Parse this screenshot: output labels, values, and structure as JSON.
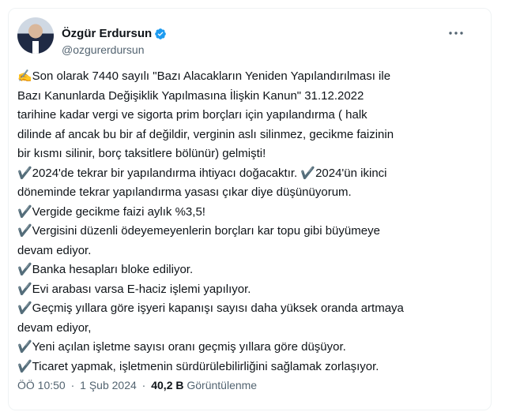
{
  "author": {
    "name": "Özgür Erdursun",
    "handle": "@ozgurerdursun",
    "verified_icon": "verified-badge-icon",
    "more_icon": "more-dots-icon"
  },
  "tweet": {
    "lines": [
      "✍️Son olarak 7440 sayılı \"Bazı Alacakların Yeniden Yapılandırılması ile",
      "Bazı Kanunlarda Değişiklik Yapılmasına İlişkin Kanun\"  31.12.2022",
      "tarihine kadar vergi ve sigorta prim borçları için yapılandırma ( halk",
      "dilinde af ancak bu bir af değildir, verginin aslı silinmez, gecikme faizinin",
      "bir kısmı silinir, borç taksitlere bölünür) gelmişti!",
      "✔️2024'de tekrar bir yapılandırma ihtiyacı doğacaktır. ✔️2024'ün ikinci",
      "döneminde tekrar yapılandırma yasası çıkar diye düşünüyorum.",
      "✔️Vergide gecikme faizi aylık %3,5!",
      "✔️Vergisini düzenli ödeyemeyenlerin borçları kar topu gibi büyümeye",
      "devam ediyor.",
      "✔️Banka hesapları bloke ediliyor.",
      "✔️Evi arabası varsa E-haciz işlemi yapılıyor.",
      "✔️Geçmiş yıllara göre işyeri kapanışı sayısı daha yüksek oranda artmaya",
      "devam ediyor,",
      "✔️Yeni açılan işletme sayısı oranı geçmiş yıllara göre düşüyor.",
      "✔️Ticaret yapmak, işletmenin sürdürülebilirliğini sağlamak zorlaşıyor."
    ]
  },
  "meta": {
    "time": "ÖÖ 10:50",
    "dot": "·",
    "date": "1 Şub 2024",
    "views_count": "40,2 B",
    "views_label": "Görüntülenme"
  },
  "colors": {
    "verified": "#1d9bf0",
    "muted": "#536471",
    "text": "#0f1419"
  }
}
